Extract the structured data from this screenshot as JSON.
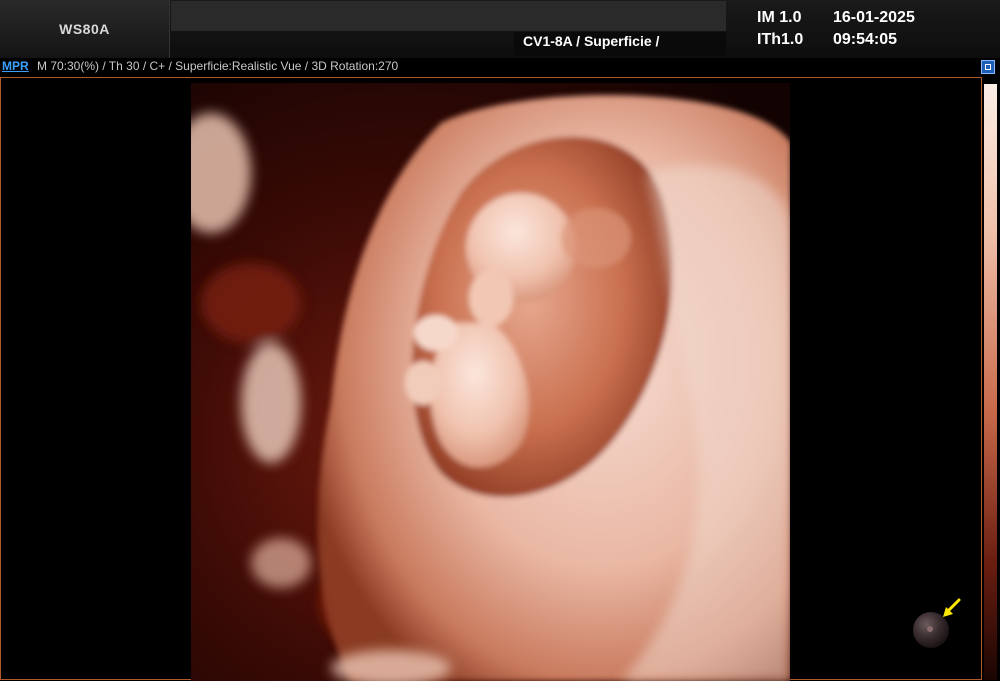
{
  "header": {
    "system_name": "WS80A",
    "probe_preset": "CV1-8A / Superficie /",
    "im_label": "IM  1.0",
    "ith_label": "ITh1.0",
    "date": "16-01-2025",
    "time": "09:54:05"
  },
  "status": {
    "mpr_tab": "MPR",
    "parameters": "M 70:30(%) / Th 30 / C+ / Superficie:Realistic Vue / 3D Rotation:270"
  },
  "colors": {
    "accent_link": "#3aa0ff",
    "viewport_border": "#b05a2a",
    "arrow": "#ffe600"
  },
  "icons": {
    "view_toggle": "square-button-icon",
    "orientation": "orientation-ball-icon",
    "pointer": "yellow-arrow-icon"
  }
}
